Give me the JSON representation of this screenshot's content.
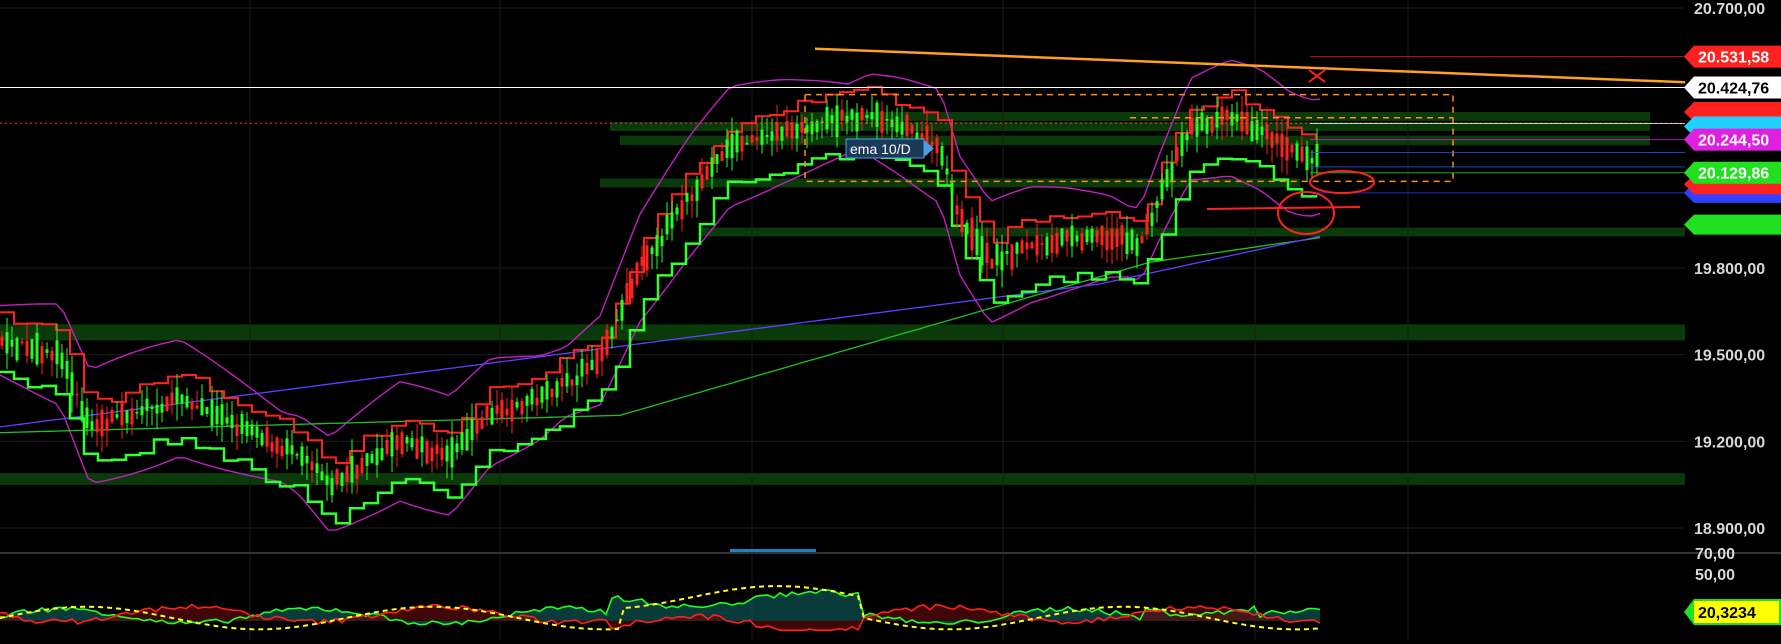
{
  "chart_data": [
    {
      "type": "candlestick",
      "ylim": [
        18850,
        20700
      ],
      "y_ticks": [
        {
          "value": 20700,
          "label": "20.700,00"
        },
        {
          "value": 19800,
          "label": "19.800,00"
        },
        {
          "value": 19500,
          "label": "19.500,00"
        },
        {
          "value": 19200,
          "label": "19.200,00"
        },
        {
          "value": 18900,
          "label": "18.900,00"
        }
      ],
      "last_price": {
        "value": 20424.76,
        "label": "20.424,76"
      },
      "price_tags": [
        {
          "value": 20531.58,
          "label": "20.531,58",
          "color": "#ff2020"
        },
        {
          "value": 20244.5,
          "label": "20.244,50",
          "color": "#e020e0"
        },
        {
          "value": 20129.86,
          "label": "20.129,86",
          "color": "#20e020"
        }
      ],
      "annotation": {
        "text": "ema 10/D"
      },
      "grid": true,
      "colors": {
        "up": "#20ff20",
        "down": "#ff2020",
        "bollinger": "#c020c0",
        "trend_line": "#ffa020",
        "ema_long": "#20c020",
        "ema_slow": "#6040ff",
        "support_zone": "#0a3a0a"
      }
    },
    {
      "type": "area",
      "ylim": [
        0,
        85
      ],
      "y_ticks": [
        {
          "value": 70,
          "label": "70,00"
        },
        {
          "value": 50,
          "label": "50,00"
        }
      ],
      "last_value": {
        "value": 20.3234,
        "label": "20,3234",
        "color": "#ffff00"
      },
      "series_colors": {
        "green_line": "#20ff20",
        "red_line": "#ff2020",
        "signal": "#ffff20"
      }
    }
  ]
}
